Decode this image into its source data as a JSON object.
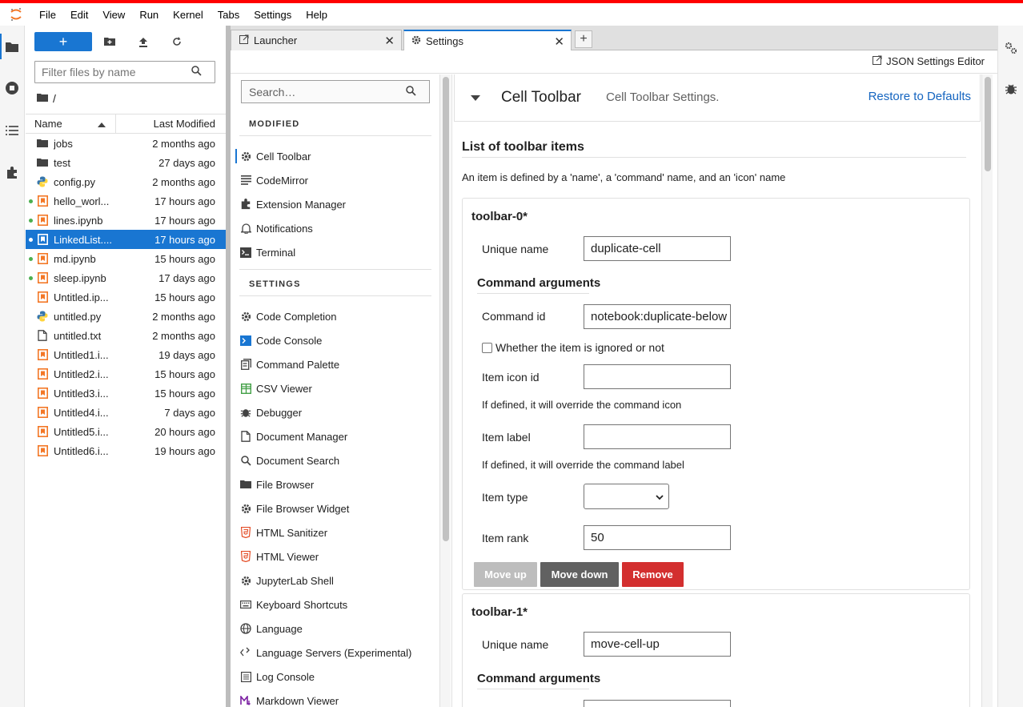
{
  "menubar": {
    "items": [
      "File",
      "Edit",
      "View",
      "Run",
      "Kernel",
      "Tabs",
      "Settings",
      "Help"
    ]
  },
  "filebrowser": {
    "new_label": "+",
    "filter_placeholder": "Filter files by name",
    "breadcrumb": "/",
    "col_name": "Name",
    "col_modified": "Last Modified",
    "files": [
      {
        "name": "jobs",
        "modified": "2 months ago",
        "type": "folder",
        "running": false,
        "selected": false
      },
      {
        "name": "test",
        "modified": "27 days ago",
        "type": "folder",
        "running": false,
        "selected": false
      },
      {
        "name": "config.py",
        "modified": "2 months ago",
        "type": "python",
        "running": false,
        "selected": false
      },
      {
        "name": "hello_worl...",
        "modified": "17 hours ago",
        "type": "notebook",
        "running": true,
        "selected": false
      },
      {
        "name": "lines.ipynb",
        "modified": "17 hours ago",
        "type": "notebook",
        "running": true,
        "selected": false
      },
      {
        "name": "LinkedList....",
        "modified": "17 hours ago",
        "type": "notebook",
        "running": true,
        "selected": true
      },
      {
        "name": "md.ipynb",
        "modified": "15 hours ago",
        "type": "notebook",
        "running": true,
        "selected": false
      },
      {
        "name": "sleep.ipynb",
        "modified": "17 days ago",
        "type": "notebook",
        "running": true,
        "selected": false
      },
      {
        "name": "Untitled.ip...",
        "modified": "15 hours ago",
        "type": "notebook",
        "running": false,
        "selected": false
      },
      {
        "name": "untitled.py",
        "modified": "2 months ago",
        "type": "python",
        "running": false,
        "selected": false
      },
      {
        "name": "untitled.txt",
        "modified": "2 months ago",
        "type": "text",
        "running": false,
        "selected": false
      },
      {
        "name": "Untitled1.i...",
        "modified": "19 days ago",
        "type": "notebook",
        "running": false,
        "selected": false
      },
      {
        "name": "Untitled2.i...",
        "modified": "15 hours ago",
        "type": "notebook",
        "running": false,
        "selected": false
      },
      {
        "name": "Untitled3.i...",
        "modified": "15 hours ago",
        "type": "notebook",
        "running": false,
        "selected": false
      },
      {
        "name": "Untitled4.i...",
        "modified": "7 days ago",
        "type": "notebook",
        "running": false,
        "selected": false
      },
      {
        "name": "Untitled5.i...",
        "modified": "20 hours ago",
        "type": "notebook",
        "running": false,
        "selected": false
      },
      {
        "name": "Untitled6.i...",
        "modified": "19 hours ago",
        "type": "notebook",
        "running": false,
        "selected": false
      }
    ]
  },
  "tabs": [
    {
      "label": "Launcher",
      "icon": "launcher-icon",
      "active": false
    },
    {
      "label": "Settings",
      "icon": "gear-icon",
      "active": true
    }
  ],
  "settings_toolbar": {
    "json_editor_label": "JSON Settings Editor"
  },
  "settings_nav": {
    "search_placeholder": "Search…",
    "modified_header": "MODIFIED",
    "settings_header": "SETTINGS",
    "modified_items": [
      {
        "label": "Cell Toolbar",
        "icon": "gear-icon",
        "active": true
      },
      {
        "label": "CodeMirror",
        "icon": "lines-icon",
        "active": false
      },
      {
        "label": "Extension Manager",
        "icon": "puzzle-icon",
        "active": false
      },
      {
        "label": "Notifications",
        "icon": "bell-icon",
        "active": false
      },
      {
        "label": "Terminal",
        "icon": "terminal-icon",
        "active": false
      }
    ],
    "settings_items": [
      {
        "label": "Code Completion",
        "icon": "gear-icon"
      },
      {
        "label": "Code Console",
        "icon": "console-icon"
      },
      {
        "label": "Command Palette",
        "icon": "palette-icon"
      },
      {
        "label": "CSV Viewer",
        "icon": "csv-icon"
      },
      {
        "label": "Debugger",
        "icon": "bug-icon"
      },
      {
        "label": "Document Manager",
        "icon": "document-icon"
      },
      {
        "label": "Document Search",
        "icon": "search-icon"
      },
      {
        "label": "File Browser",
        "icon": "folder-icon"
      },
      {
        "label": "File Browser Widget",
        "icon": "gear-icon"
      },
      {
        "label": "HTML Sanitizer",
        "icon": "html5-icon"
      },
      {
        "label": "HTML Viewer",
        "icon": "html5-icon"
      },
      {
        "label": "JupyterLab Shell",
        "icon": "gear-icon"
      },
      {
        "label": "Keyboard Shortcuts",
        "icon": "keyboard-icon"
      },
      {
        "label": "Language",
        "icon": "globe-icon"
      },
      {
        "label": "Language Servers (Experimental)",
        "icon": "code-icon"
      },
      {
        "label": "Log Console",
        "icon": "list-icon"
      },
      {
        "label": "Markdown Viewer",
        "icon": "markdown-icon"
      }
    ]
  },
  "panel": {
    "title": "Cell Toolbar",
    "description": "Cell Toolbar Settings.",
    "restore_label": "Restore to Defaults",
    "form_title": "List of toolbar items",
    "form_hint": "An item is defined by a 'name', a 'command' name, and an 'icon' name",
    "items": [
      {
        "title": "toolbar-0*",
        "unique_name_label": "Unique name",
        "unique_name_value": "duplicate-cell",
        "command_args_label": "Command arguments",
        "command_id_label": "Command id",
        "command_id_value": "notebook:duplicate-below",
        "ignored_label": "Whether the item is ignored or not",
        "icon_id_label": "Item icon id",
        "icon_id_value": "",
        "icon_help": "If defined, it will override the command icon",
        "item_label_label": "Item label",
        "item_label_value": "",
        "label_help": "If defined, it will override the command label",
        "item_type_label": "Item type",
        "item_type_value": "",
        "item_rank_label": "Item rank",
        "item_rank_value": "50",
        "move_up_label": "Move up",
        "move_down_label": "Move down",
        "remove_label": "Remove"
      },
      {
        "title": "toolbar-1*",
        "unique_name_label": "Unique name",
        "unique_name_value": "move-cell-up",
        "command_args_label": "Command arguments"
      }
    ]
  },
  "colors": {
    "accent": "#1976d2",
    "running_dot": "#4caf50",
    "notebook_icon": "#f37726",
    "remove_button": "#d32f2f",
    "move_down_button": "#616161",
    "move_up_button": "#bdbdbd",
    "top_line": "#ff0000"
  }
}
